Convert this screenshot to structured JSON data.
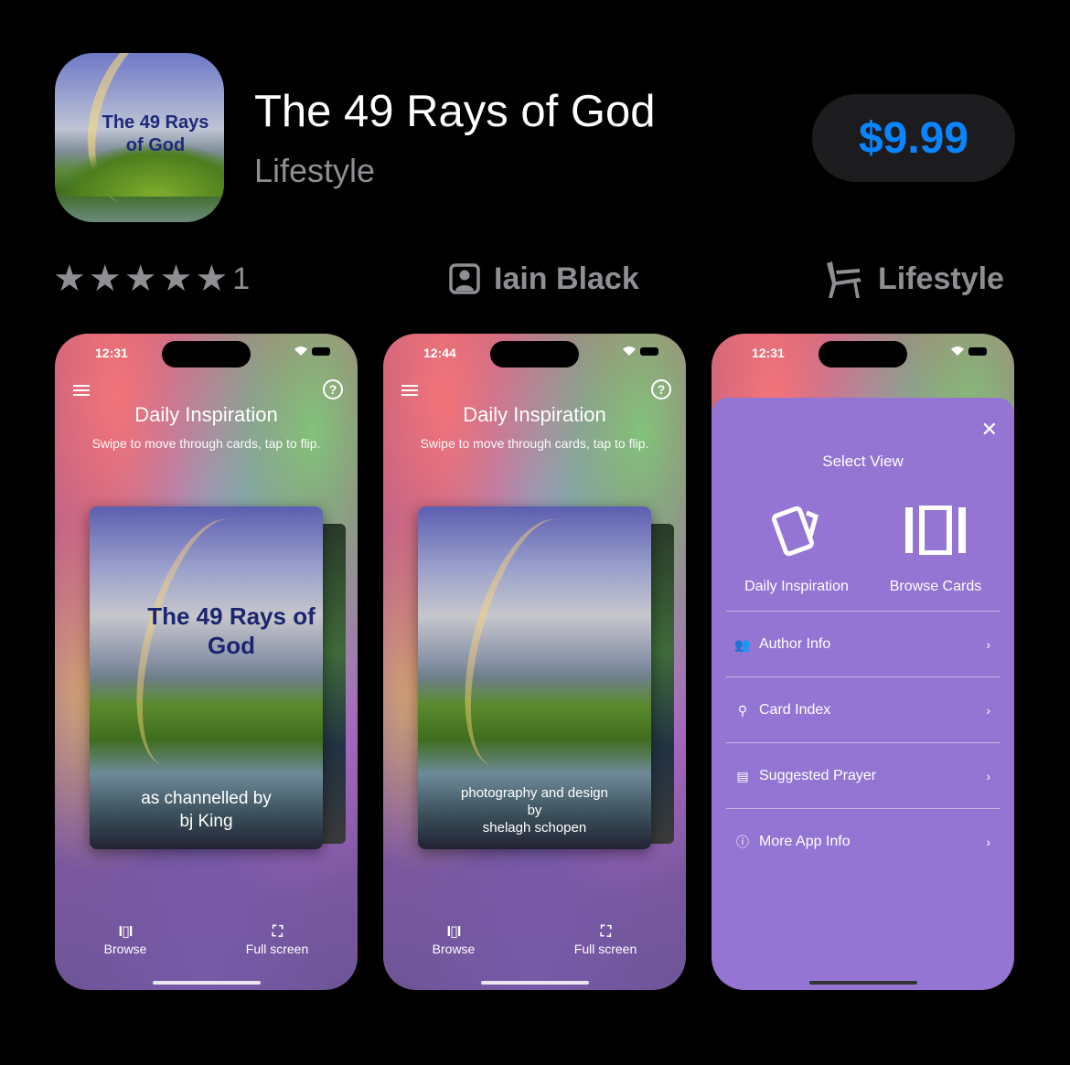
{
  "app": {
    "title": "The 49 Rays of God",
    "subtitle": "Lifestyle",
    "price": "$9.99",
    "icon_text": "The 49 Rays of God"
  },
  "meta": {
    "rating_stars": 5,
    "rating_count": "1",
    "developer": "Iain Black",
    "category": "Lifestyle",
    "icons": {
      "developer": "person-square-icon",
      "category": "chair-icon"
    }
  },
  "screenshots": [
    {
      "time": "12:31",
      "screen_title": "Daily Inspiration",
      "screen_hint": "Swipe to move through cards, tap to flip.",
      "card_title": "The 49 Rays of God",
      "card_caption_1": "as channelled by",
      "card_caption_2": "bj King",
      "browse_label": "Browse",
      "fullscreen_label": "Full screen"
    },
    {
      "time": "12:44",
      "screen_title": "Daily Inspiration",
      "screen_hint": "Swipe to move through cards, tap to flip.",
      "card_caption_1": "photography and design",
      "card_caption_2": "by",
      "card_caption_3": "shelagh schopen",
      "browse_label": "Browse",
      "fullscreen_label": "Full screen"
    },
    {
      "time": "12:31",
      "sheet_title": "Select View",
      "view_options": [
        "Daily Inspiration",
        "Browse Cards"
      ],
      "rows": [
        {
          "label": "Author Info",
          "icon": "people-icon"
        },
        {
          "label": "Card Index",
          "icon": "search-icon"
        },
        {
          "label": "Suggested Prayer",
          "icon": "scroll-icon"
        },
        {
          "label": "More App Info",
          "icon": "info-icon"
        }
      ]
    }
  ],
  "colors": {
    "price": "#0a84ff",
    "sheet": "#9575d3",
    "meta_text": "#8e8e93"
  }
}
